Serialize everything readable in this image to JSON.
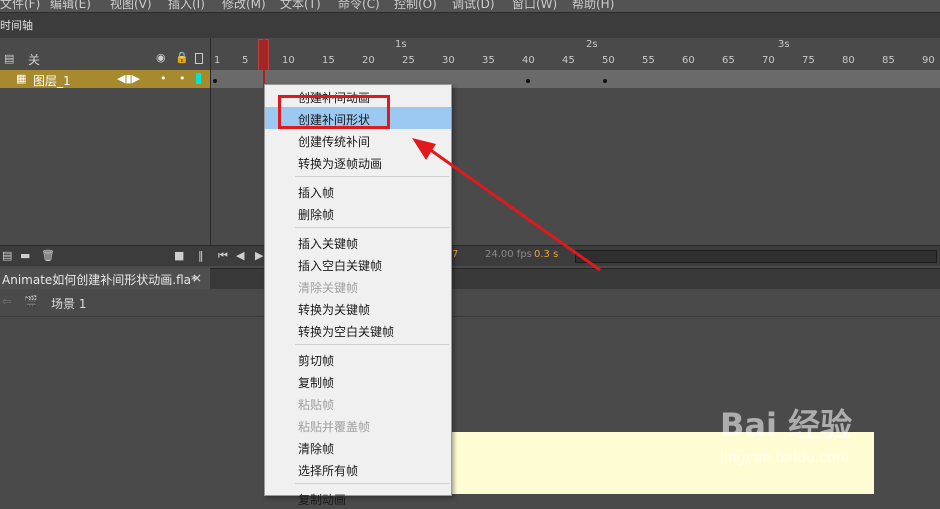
{
  "menubar": {
    "items": [
      "文件(F)",
      "编辑(E)",
      "视图(V)",
      "插入(I)",
      "修改(M)",
      "文本(T)",
      "命令(C)",
      "控制(O)",
      "调试(D)",
      "窗口(W)",
      "帮助(H)"
    ]
  },
  "timeline": {
    "panel_title": "时间轴",
    "layers_header": "关",
    "layer_name": "图层_1",
    "seconds": [
      "1s",
      "2s",
      "3s"
    ],
    "frame_numbers": [
      "1",
      "5",
      "10",
      "15",
      "20",
      "25",
      "30",
      "35",
      "40",
      "45",
      "50",
      "55",
      "60",
      "65",
      "70",
      "75",
      "80",
      "85",
      "90"
    ],
    "status": {
      "frame": "7",
      "fps": "24.00 fps",
      "time": "0.3 s"
    }
  },
  "document": {
    "tab_title": "Animate如何创建补间形状动画.fla*",
    "scene_label": "场景 1"
  },
  "context_menu": {
    "items": [
      {
        "label": "创建补间动画",
        "state": "normal"
      },
      {
        "label": "创建补间形状",
        "state": "highlighted"
      },
      {
        "label": "创建传统补间",
        "state": "normal"
      },
      {
        "label": "转换为逐帧动画",
        "state": "normal"
      },
      {
        "label": "插入帧",
        "state": "normal"
      },
      {
        "label": "删除帧",
        "state": "normal"
      },
      {
        "label": "插入关键帧",
        "state": "normal"
      },
      {
        "label": "插入空白关键帧",
        "state": "normal"
      },
      {
        "label": "清除关键帧",
        "state": "disabled"
      },
      {
        "label": "转换为关键帧",
        "state": "normal"
      },
      {
        "label": "转换为空白关键帧",
        "state": "normal"
      },
      {
        "label": "剪切帧",
        "state": "normal"
      },
      {
        "label": "复制帧",
        "state": "normal"
      },
      {
        "label": "粘贴帧",
        "state": "disabled"
      },
      {
        "label": "粘贴并覆盖帧",
        "state": "disabled"
      },
      {
        "label": "清除帧",
        "state": "normal"
      },
      {
        "label": "选择所有帧",
        "state": "normal"
      },
      {
        "label": "复制动画",
        "state": "normal"
      }
    ]
  },
  "watermark": {
    "logo_text": "Bai 经验",
    "url": "jingyan.baidu.com"
  },
  "colors": {
    "highlight": "#9cc9f2",
    "annotation": "#e0191c",
    "layer_bar": "#a88a2e",
    "playhead": "#b02020",
    "canvas": "#fefcd2"
  }
}
